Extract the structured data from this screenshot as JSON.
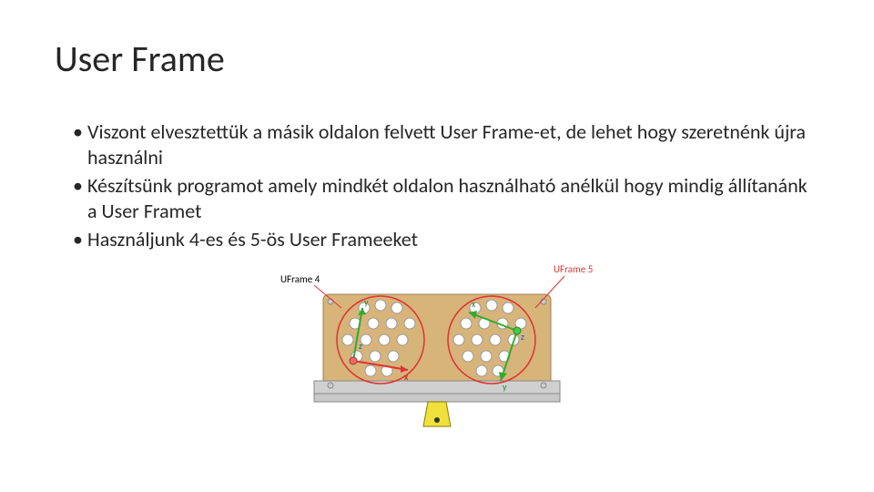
{
  "title": "User Frame",
  "bullets": [
    "Viszont elvesztettük a másik oldalon felvett User Frame-et, de lehet hogy szeretnénk újra használni",
    "Készítsünk programot amely mindkét oldalon használható anélkül hogy mindig állítanánk a User Framet",
    "Használjunk 4-es és 5-ös User Frameeket"
  ],
  "figure": {
    "label_left": "UFrame 4",
    "label_right": "UFrame 5",
    "axis_x": "x",
    "axis_y": "y",
    "axis_z": "z",
    "axis_x2": "x",
    "axis_y2": "y",
    "axis_z2": "z"
  }
}
